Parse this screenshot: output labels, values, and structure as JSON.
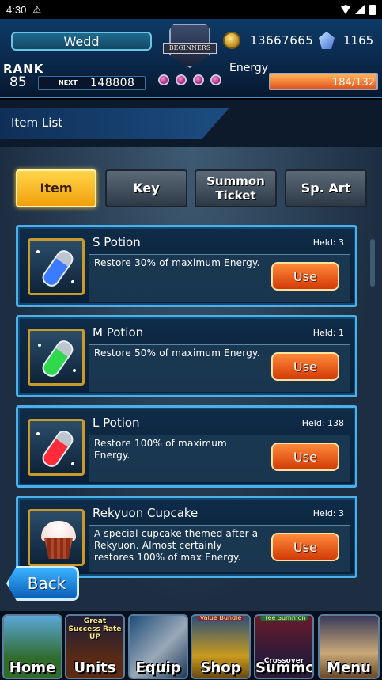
{
  "status_bar": {
    "time": "4:30",
    "alert": "⚠"
  },
  "header": {
    "player_name": "Wedd",
    "emblem_text": "BEGINNERS",
    "gold": "13667665",
    "gems": "1165",
    "rank_label": "RANK",
    "rank": "85",
    "next_label": "NEXT",
    "next_exp": "148808",
    "energy_label": "Energy",
    "energy_text": "184/132",
    "energy_fill_fraction": 1.0
  },
  "page_title": "Item List",
  "tabs": [
    {
      "label": "Item",
      "active": true
    },
    {
      "label": "Key",
      "active": false
    },
    {
      "label": "Summon Ticket",
      "active": false
    },
    {
      "label": "Sp. Art",
      "active": false
    }
  ],
  "items": [
    {
      "name": "S Potion",
      "held": "Held: 3",
      "description": "Restore 30% of maximum Energy.",
      "use_label": "Use",
      "potion_color": "#3a7bff"
    },
    {
      "name": "M Potion",
      "held": "Held: 1",
      "description": "Restore 50% of maximum Energy.",
      "use_label": "Use",
      "potion_color": "#2fd94c"
    },
    {
      "name": "L Potion",
      "held": "Held: 138",
      "description": "Restore 100% of maximum Energy.",
      "use_label": "Use",
      "potion_color": "#ff2a3a"
    },
    {
      "name": "Rekyuon Cupcake",
      "held": "Held: 3",
      "description": "A special cupcake themed after a Rekyuon. Almost certainly restores 100% of max Energy.",
      "use_label": "Use",
      "icon": "cupcake-icon"
    }
  ],
  "back_label": "Back",
  "nav": [
    {
      "label": "Home",
      "tag": "",
      "icon": "house-icon"
    },
    {
      "label": "Units",
      "tag": "Great Success Rate UP",
      "icon": "unit-icon"
    },
    {
      "label": "Equip",
      "tag": "",
      "icon": "sword-icon"
    },
    {
      "label": "Shop",
      "tag": "Value Bundle",
      "icon": "treasure-icon"
    },
    {
      "label": "Summon",
      "tag": "Free Summon",
      "subtag": "Crossover",
      "icon": "summon-icon"
    },
    {
      "label": "Menu",
      "tag": "",
      "icon": "book-icon"
    }
  ],
  "colors": {
    "accent": "#4bb1ea",
    "use_button": "#e2541b",
    "active_tab": "#ffca40"
  }
}
